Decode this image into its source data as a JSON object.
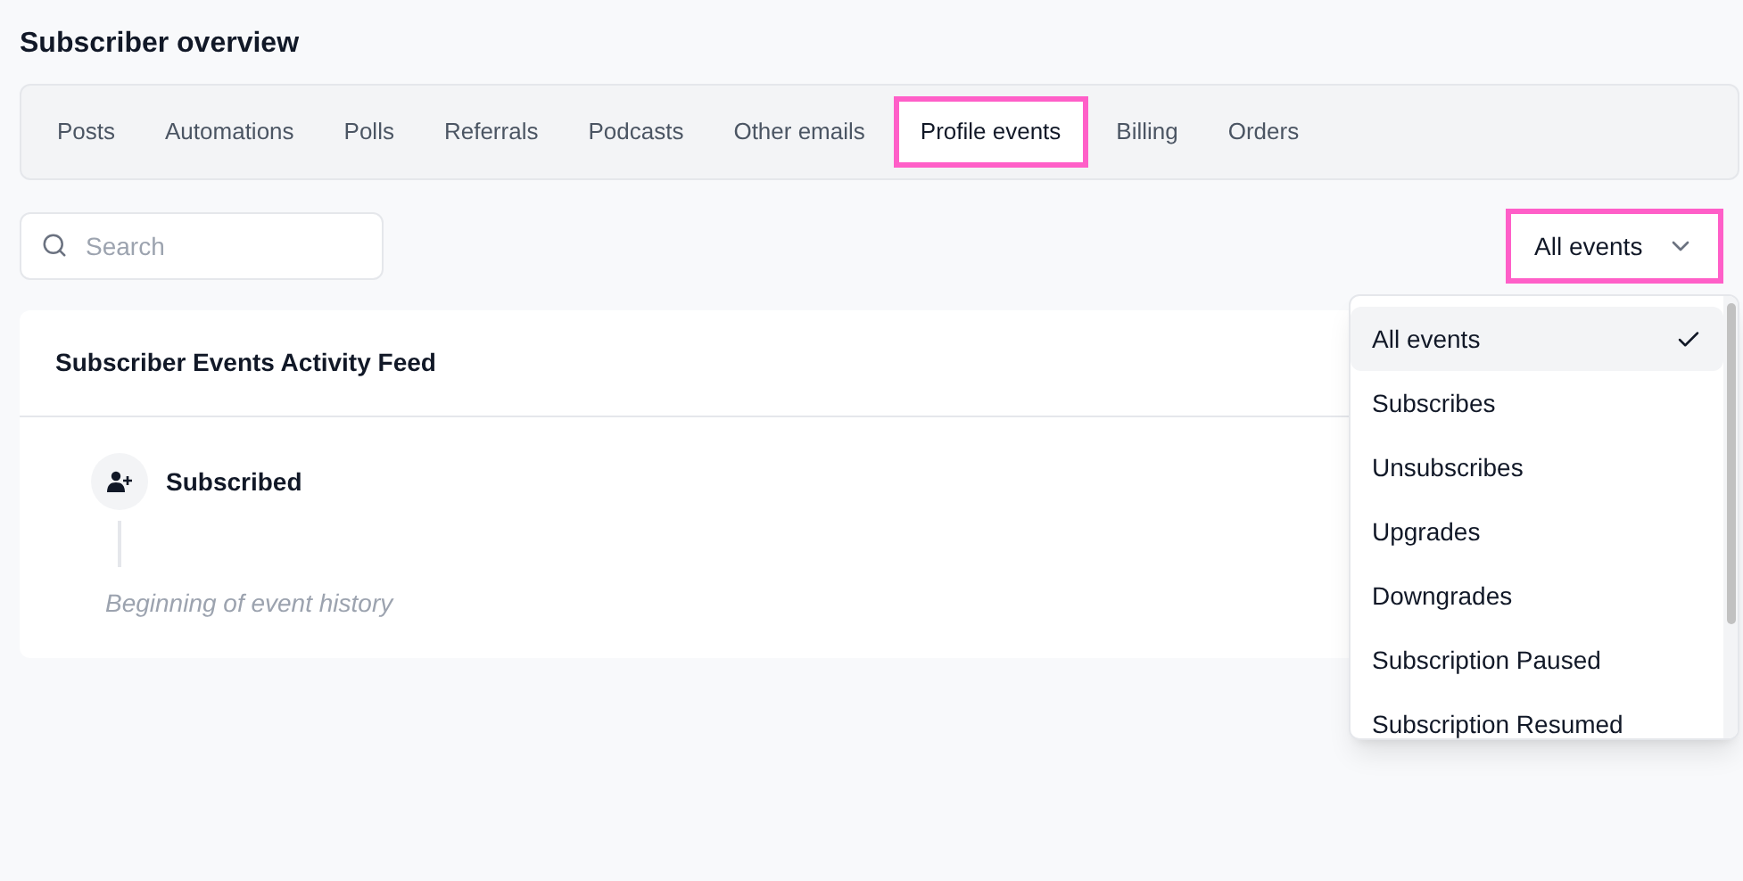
{
  "page": {
    "title": "Subscriber overview"
  },
  "tabs": [
    {
      "label": "Posts",
      "selected": false
    },
    {
      "label": "Automations",
      "selected": false
    },
    {
      "label": "Polls",
      "selected": false
    },
    {
      "label": "Referrals",
      "selected": false
    },
    {
      "label": "Podcasts",
      "selected": false
    },
    {
      "label": "Other emails",
      "selected": false
    },
    {
      "label": "Profile events",
      "selected": true
    },
    {
      "label": "Billing",
      "selected": false
    },
    {
      "label": "Orders",
      "selected": false
    }
  ],
  "search": {
    "placeholder": "Search"
  },
  "filter": {
    "value": "All events",
    "expanded": true,
    "options": [
      {
        "label": "All events",
        "selected": true
      },
      {
        "label": "Subscribes",
        "selected": false
      },
      {
        "label": "Unsubscribes",
        "selected": false
      },
      {
        "label": "Upgrades",
        "selected": false
      },
      {
        "label": "Downgrades",
        "selected": false
      },
      {
        "label": "Subscription Paused",
        "selected": false
      },
      {
        "label": "Subscription Resumed",
        "selected": false
      }
    ]
  },
  "feed": {
    "title": "Subscriber Events Activity Feed",
    "events": [
      {
        "label": "Subscribed"
      }
    ],
    "end_note": "Beginning of event history"
  }
}
